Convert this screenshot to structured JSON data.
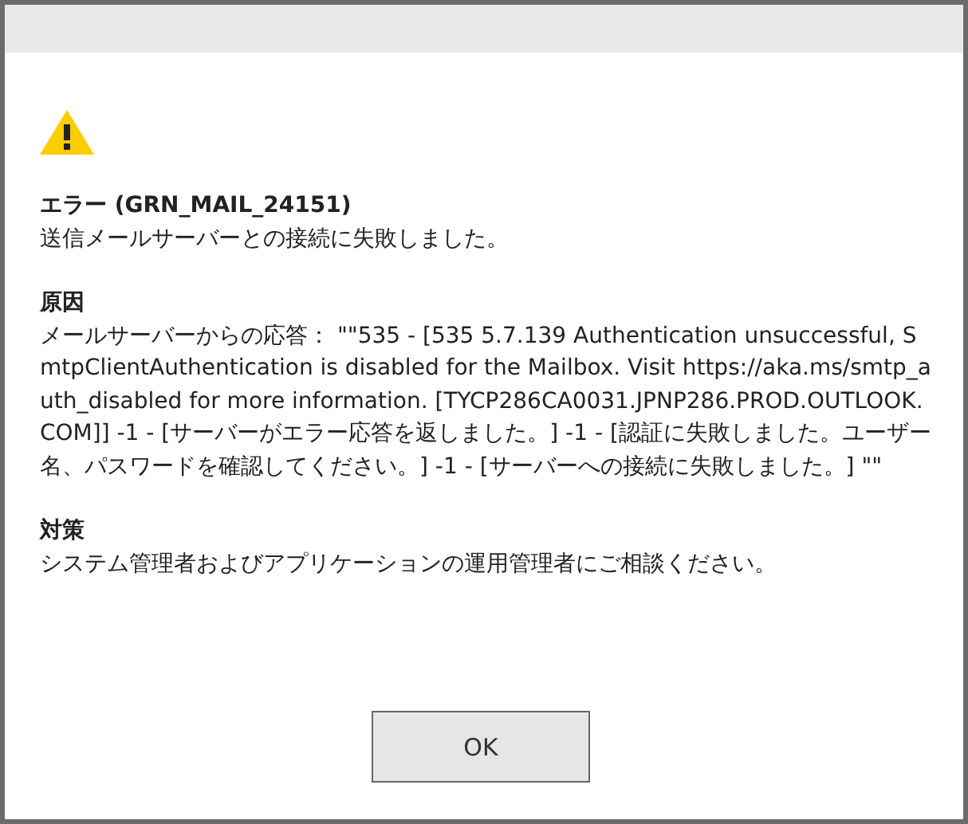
{
  "error": {
    "title": "エラー (GRN_MAIL_24151)",
    "message": "送信メールサーバーとの接続に失敗しました。"
  },
  "sections": [
    {
      "heading": "原因",
      "text": "メールサーバーからの応答： \"\"535 - [535 5.7.139 Authentication unsuccessful, SmtpClientAuthentication is disabled for the Mailbox. Visit https://aka.ms/smtp_auth_disabled for more information. [TYCP286CA0031.JPNP286.PROD.OUTLOOK.COM]] -1 - [サーバーがエラー応答を返しました。] -1 - [認証に失敗しました。ユーザー名、パスワードを確認してください。] -1 - [サーバーへの接続に失敗しました。] \"\""
    },
    {
      "heading": "対策",
      "text": "システム管理者およびアプリケーションの運用管理者にご相談ください。"
    }
  ],
  "buttons": [
    "OK"
  ]
}
